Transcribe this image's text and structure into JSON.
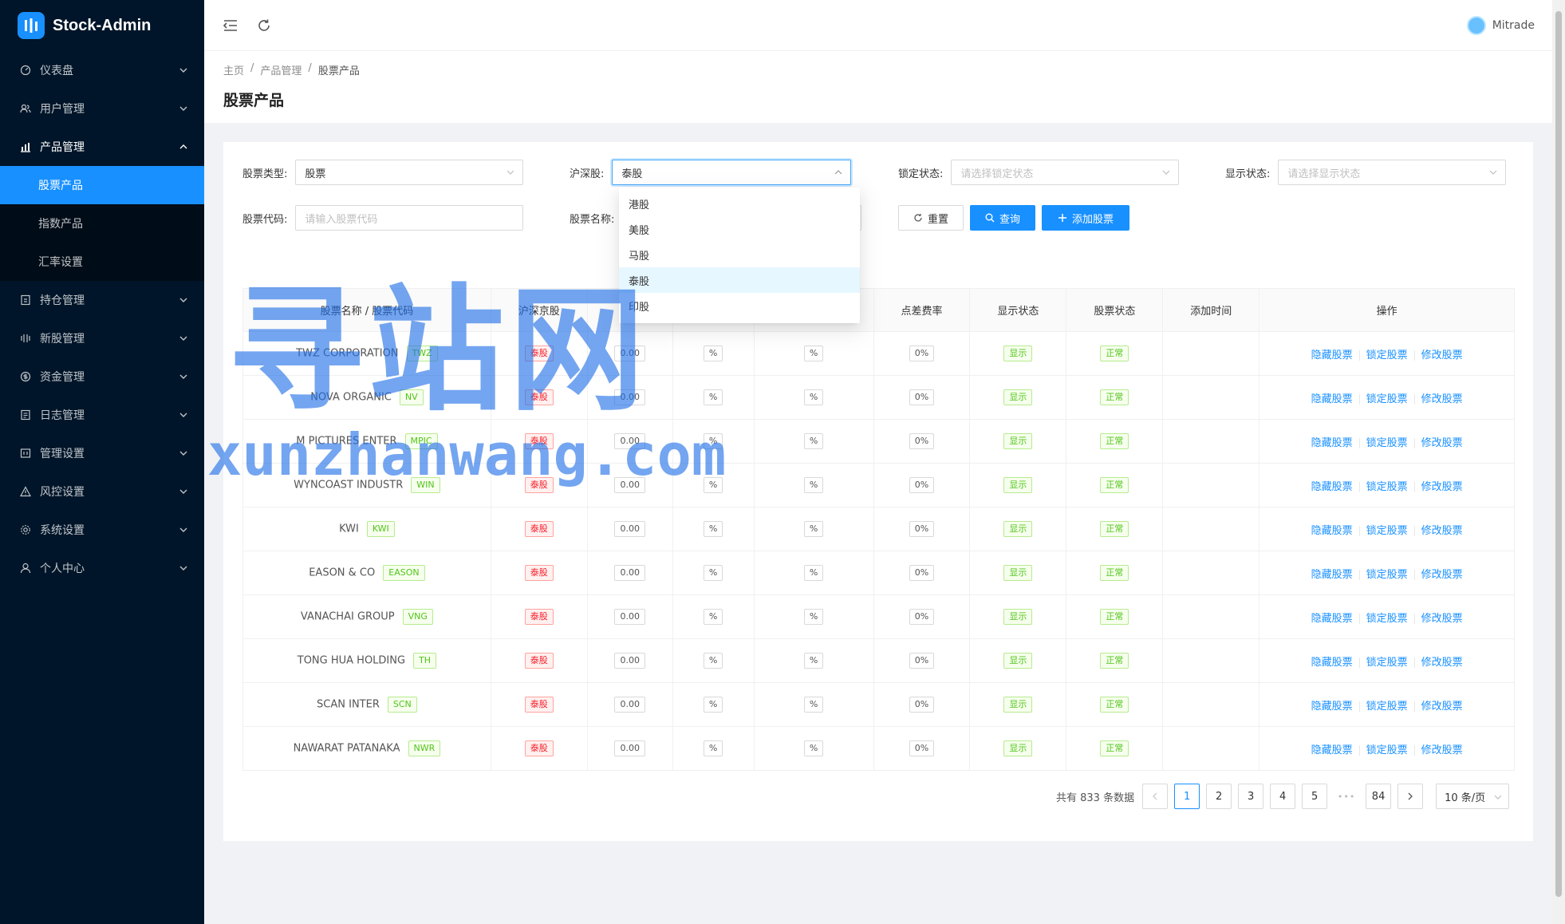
{
  "app": {
    "name": "Stock-Admin",
    "user": "Mitrade"
  },
  "sidebar": {
    "items": [
      {
        "label": "仪表盘",
        "icon": "dashboard-icon"
      },
      {
        "label": "用户管理",
        "icon": "users-icon"
      },
      {
        "label": "产品管理",
        "icon": "chart-icon",
        "open": true,
        "children": [
          "股票产品",
          "指数产品",
          "汇率设置"
        ]
      },
      {
        "label": "持仓管理",
        "icon": "position-icon"
      },
      {
        "label": "新股管理",
        "icon": "ipo-icon"
      },
      {
        "label": "资金管理",
        "icon": "money-icon"
      },
      {
        "label": "日志管理",
        "icon": "log-icon"
      },
      {
        "label": "管理设置",
        "icon": "admin-settings-icon"
      },
      {
        "label": "风控设置",
        "icon": "warning-icon"
      },
      {
        "label": "系统设置",
        "icon": "gear-icon"
      },
      {
        "label": "个人中心",
        "icon": "user-icon"
      }
    ]
  },
  "breadcrumb": [
    "主页",
    "产品管理",
    "股票产品"
  ],
  "page_title": "股票产品",
  "filters": {
    "stock_type_label": "股票类型:",
    "stock_type_value": "股票",
    "market_label": "沪深股:",
    "market_value": "泰股",
    "lock_label": "锁定状态:",
    "lock_placeholder": "请选择锁定状态",
    "display_label": "显示状态:",
    "display_placeholder": "请选择显示状态",
    "code_label": "股票代码:",
    "code_placeholder": "请输入股票代码",
    "name_label": "股票名称:",
    "reset_label": "重置",
    "query_label": "查询",
    "add_label": "添加股票"
  },
  "market_options": [
    "港股",
    "美股",
    "马股",
    "泰股",
    "印股"
  ],
  "table": {
    "headers": [
      "股票名称 / 股票代码",
      "沪深京股",
      "",
      "",
      "",
      "点差费率",
      "显示状态",
      "股票状态",
      "添加时间",
      "操作"
    ],
    "rows": [
      {
        "name": "TWZ CORPORATION",
        "code": "TWZ",
        "market": "泰股",
        "price": "0.00",
        "p1": "%",
        "p2": "%",
        "spread": "0%",
        "display": "显示",
        "status": "正常"
      },
      {
        "name": "NOVA ORGANIC",
        "code": "NV",
        "market": "泰股",
        "price": "0.00",
        "p1": "%",
        "p2": "%",
        "spread": "0%",
        "display": "显示",
        "status": "正常"
      },
      {
        "name": "M PICTURES ENTER",
        "code": "MPIC",
        "market": "泰股",
        "price": "0.00",
        "p1": "%",
        "p2": "%",
        "spread": "0%",
        "display": "显示",
        "status": "正常"
      },
      {
        "name": "WYNCOAST INDUSTR",
        "code": "WIN",
        "market": "泰股",
        "price": "0.00",
        "p1": "%",
        "p2": "%",
        "spread": "0%",
        "display": "显示",
        "status": "正常"
      },
      {
        "name": "KWI",
        "code": "KWI",
        "market": "泰股",
        "price": "0.00",
        "p1": "%",
        "p2": "%",
        "spread": "0%",
        "display": "显示",
        "status": "正常"
      },
      {
        "name": "EASON & CO",
        "code": "EASON",
        "market": "泰股",
        "price": "0.00",
        "p1": "%",
        "p2": "%",
        "spread": "0%",
        "display": "显示",
        "status": "正常"
      },
      {
        "name": "VANACHAI GROUP",
        "code": "VNG",
        "market": "泰股",
        "price": "0.00",
        "p1": "%",
        "p2": "%",
        "spread": "0%",
        "display": "显示",
        "status": "正常"
      },
      {
        "name": "TONG HUA HOLDING",
        "code": "TH",
        "market": "泰股",
        "price": "0.00",
        "p1": "%",
        "p2": "%",
        "spread": "0%",
        "display": "显示",
        "status": "正常"
      },
      {
        "name": "SCAN INTER",
        "code": "SCN",
        "market": "泰股",
        "price": "0.00",
        "p1": "%",
        "p2": "%",
        "spread": "0%",
        "display": "显示",
        "status": "正常"
      },
      {
        "name": "NAWARAT PATANAKA",
        "code": "NWR",
        "market": "泰股",
        "price": "0.00",
        "p1": "%",
        "p2": "%",
        "spread": "0%",
        "display": "显示",
        "status": "正常"
      }
    ],
    "actions": [
      "隐藏股票",
      "锁定股票",
      "修改股票"
    ]
  },
  "pagination": {
    "total_text": "共有 833 条数据",
    "pages": [
      "1",
      "2",
      "3",
      "4",
      "5"
    ],
    "ellipsis": "•••",
    "last_page": "84",
    "page_size": "10 条/页"
  },
  "watermark": {
    "big": "寻站网",
    "small": "xunzhanwang.com"
  },
  "colors": {
    "sidebar_bg": "#001529",
    "primary": "#1890ff",
    "tag_red": "#f5222d",
    "tag_green": "#52c41a"
  }
}
